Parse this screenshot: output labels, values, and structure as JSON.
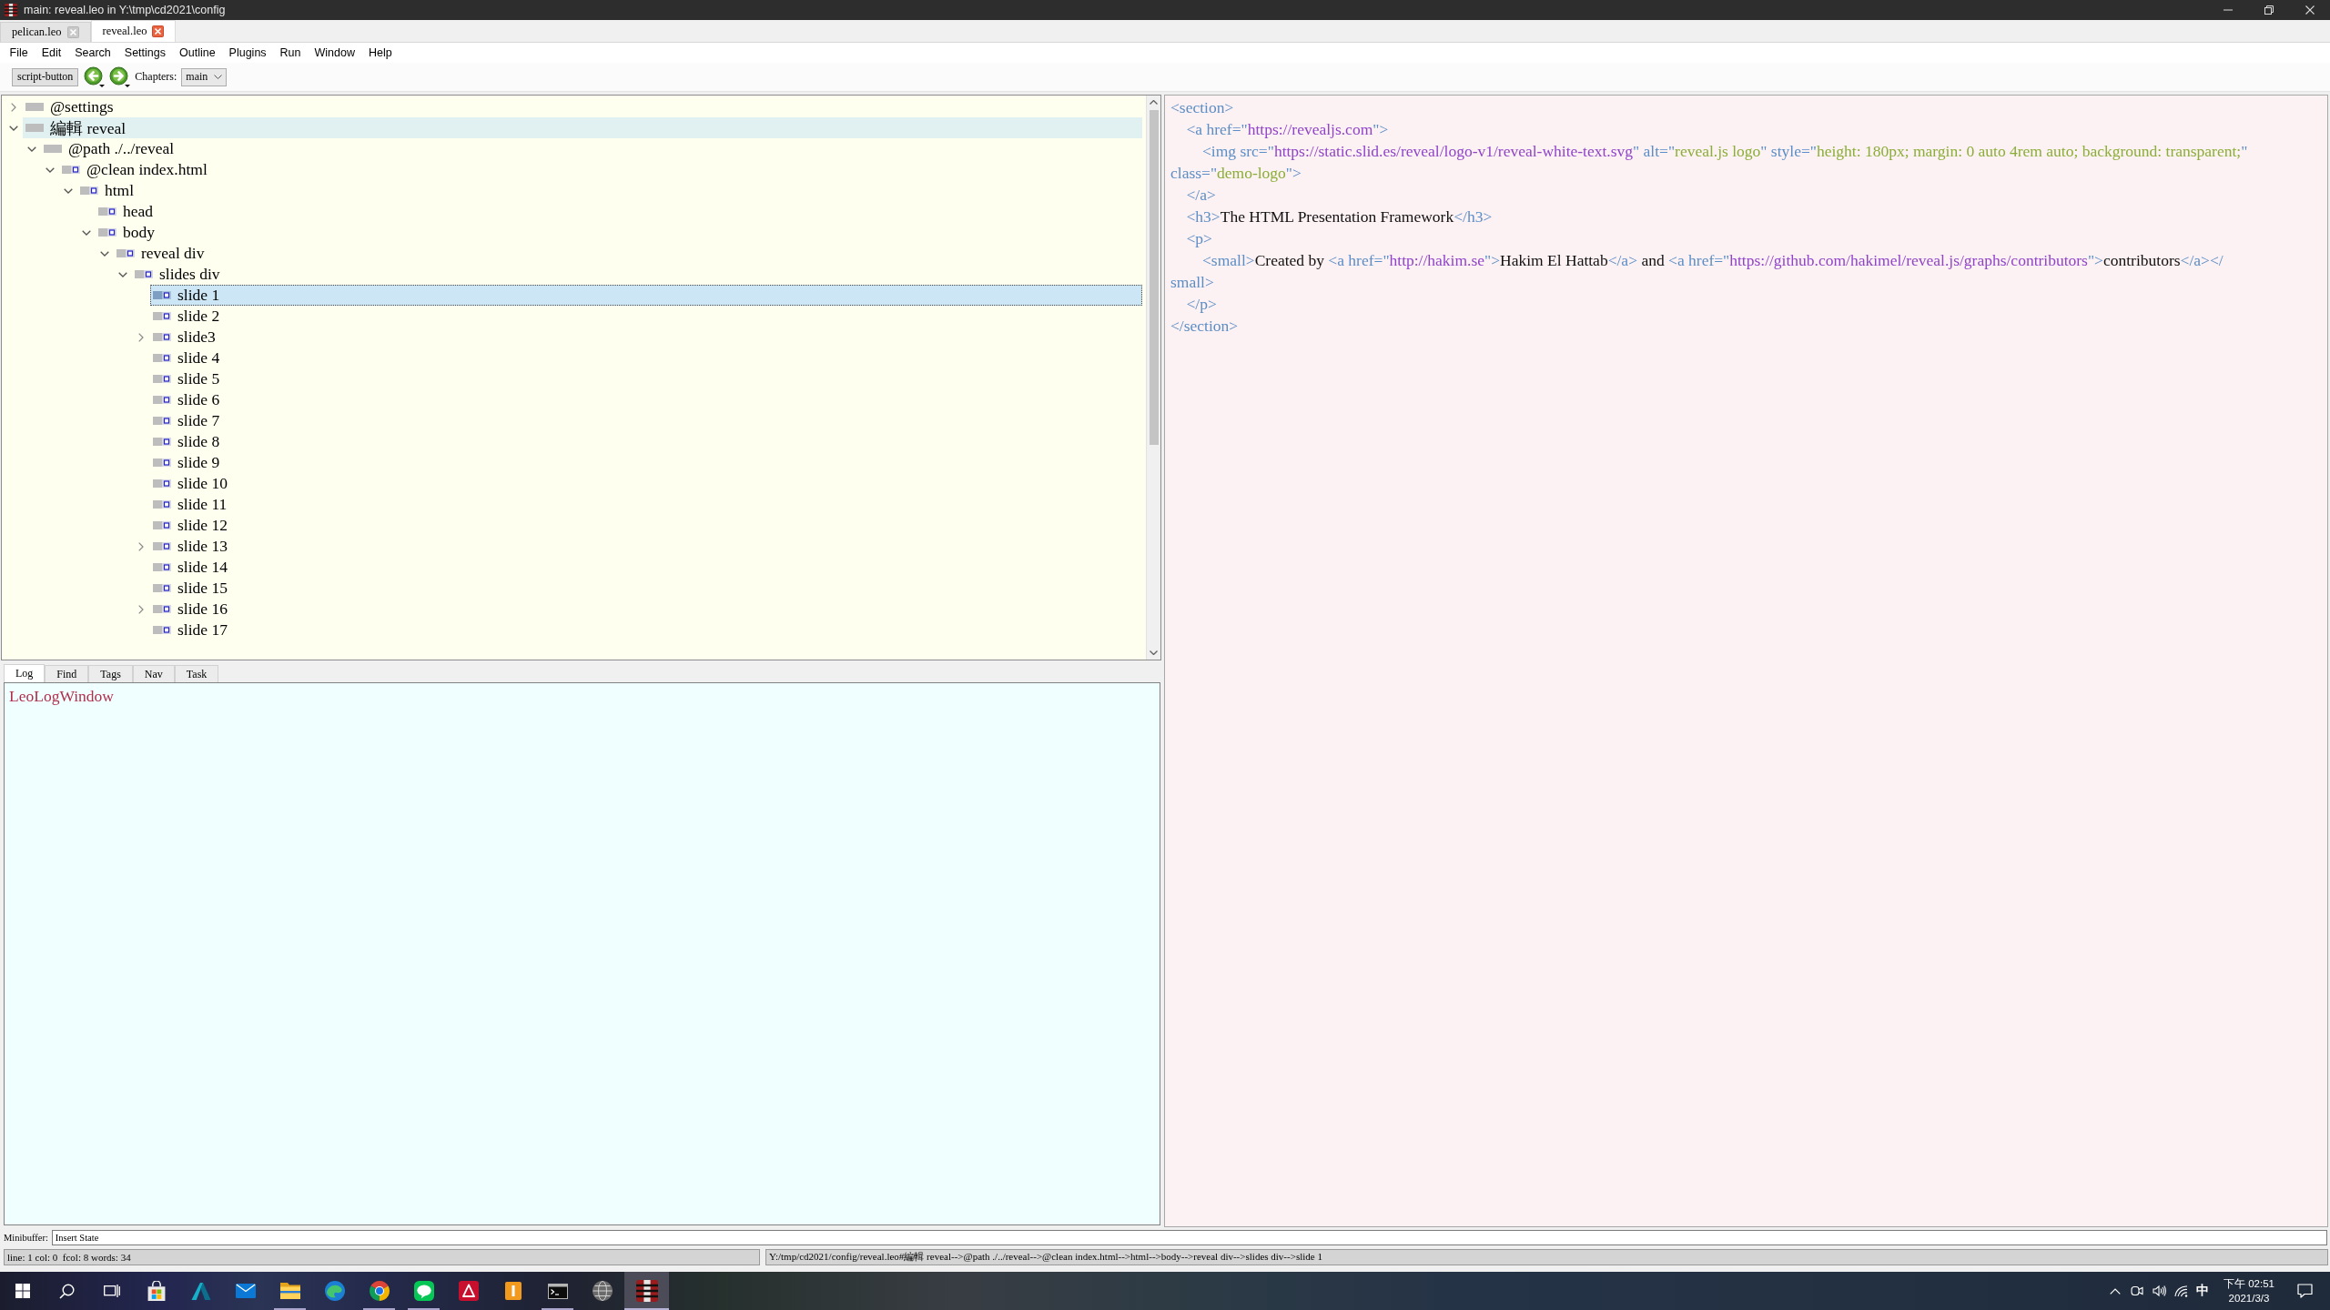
{
  "window": {
    "title": "main: reveal.leo in Y:\\tmp\\cd2021\\config"
  },
  "file_tabs": [
    {
      "label": "pelican.leo",
      "selected": false
    },
    {
      "label": "reveal.leo",
      "selected": true
    }
  ],
  "menu": [
    "File",
    "Edit",
    "Search",
    "Settings",
    "Outline",
    "Plugins",
    "Run",
    "Window",
    "Help"
  ],
  "toolbar": {
    "script_button": "script-button",
    "chapters_label": "Chapters:",
    "chapter": "main"
  },
  "outline": [
    {
      "label": "@settings",
      "kind": "branch",
      "expanded": false,
      "has_body": false,
      "selected": false,
      "hovered": false
    },
    {
      "label": "編輯 reveal",
      "kind": "branch",
      "expanded": true,
      "has_body": false,
      "selected": false,
      "hovered": true,
      "children": [
        {
          "label": "@path ./../reveal",
          "kind": "branch",
          "expanded": true,
          "has_body": false,
          "selected": false,
          "hovered": false,
          "children": [
            {
              "label": "@clean index.html",
              "kind": "branch",
              "expanded": true,
              "has_body": true,
              "selected": false,
              "hovered": false,
              "children": [
                {
                  "label": "html",
                  "kind": "branch",
                  "expanded": true,
                  "has_body": true,
                  "selected": false,
                  "hovered": false,
                  "children": [
                    {
                      "label": "head",
                      "kind": "leaf",
                      "has_body": true,
                      "selected": false,
                      "hovered": false
                    },
                    {
                      "label": "body",
                      "kind": "branch",
                      "expanded": true,
                      "has_body": true,
                      "selected": false,
                      "hovered": false,
                      "children": [
                        {
                          "label": "reveal div",
                          "kind": "branch",
                          "expanded": true,
                          "has_body": true,
                          "selected": false,
                          "hovered": false,
                          "children": [
                            {
                              "label": "slides div",
                              "kind": "branch",
                              "expanded": true,
                              "has_body": true,
                              "selected": false,
                              "hovered": false,
                              "children": [
                                {
                                  "label": "slide 1",
                                  "kind": "leaf",
                                  "has_body": true,
                                  "selected": true,
                                  "hovered": false
                                },
                                {
                                  "label": "slide 2",
                                  "kind": "leaf",
                                  "has_body": true,
                                  "selected": false,
                                  "hovered": false
                                },
                                {
                                  "label": "slide3",
                                  "kind": "branch",
                                  "expanded": false,
                                  "has_body": true,
                                  "selected": false,
                                  "hovered": false
                                },
                                {
                                  "label": "slide 4",
                                  "kind": "leaf",
                                  "has_body": true,
                                  "selected": false,
                                  "hovered": false
                                },
                                {
                                  "label": "slide 5",
                                  "kind": "leaf",
                                  "has_body": true,
                                  "selected": false,
                                  "hovered": false
                                },
                                {
                                  "label": "slide 6",
                                  "kind": "leaf",
                                  "has_body": true,
                                  "selected": false,
                                  "hovered": false
                                },
                                {
                                  "label": "slide 7",
                                  "kind": "leaf",
                                  "has_body": true,
                                  "selected": false,
                                  "hovered": false
                                },
                                {
                                  "label": "slide 8",
                                  "kind": "leaf",
                                  "has_body": true,
                                  "selected": false,
                                  "hovered": false
                                },
                                {
                                  "label": "slide 9",
                                  "kind": "leaf",
                                  "has_body": true,
                                  "selected": false,
                                  "hovered": false
                                },
                                {
                                  "label": "slide 10",
                                  "kind": "leaf",
                                  "has_body": true,
                                  "selected": false,
                                  "hovered": false
                                },
                                {
                                  "label": "slide 11",
                                  "kind": "leaf",
                                  "has_body": true,
                                  "selected": false,
                                  "hovered": false
                                },
                                {
                                  "label": "slide 12",
                                  "kind": "leaf",
                                  "has_body": true,
                                  "selected": false,
                                  "hovered": false
                                },
                                {
                                  "label": "slide 13",
                                  "kind": "branch",
                                  "expanded": false,
                                  "has_body": true,
                                  "selected": false,
                                  "hovered": false
                                },
                                {
                                  "label": "slide 14",
                                  "kind": "leaf",
                                  "has_body": true,
                                  "selected": false,
                                  "hovered": false
                                },
                                {
                                  "label": "slide 15",
                                  "kind": "leaf",
                                  "has_body": true,
                                  "selected": false,
                                  "hovered": false
                                },
                                {
                                  "label": "slide 16",
                                  "kind": "branch",
                                  "expanded": false,
                                  "has_body": true,
                                  "selected": false,
                                  "hovered": false
                                },
                                {
                                  "label": "slide 17",
                                  "kind": "leaf",
                                  "has_body": true,
                                  "selected": false,
                                  "hovered": false
                                }
                              ]
                            }
                          ]
                        }
                      ]
                    }
                  ]
                }
              ]
            }
          ]
        }
      ]
    }
  ],
  "log_tabs": [
    {
      "label": "Log",
      "selected": true
    },
    {
      "label": "Find",
      "selected": false
    },
    {
      "label": "Tags",
      "selected": false
    },
    {
      "label": "Nav",
      "selected": false
    },
    {
      "label": "Task",
      "selected": false
    }
  ],
  "log_lines": [
    "LeoLogWindow"
  ],
  "body_lines": [
    [
      {
        "kind": "tag",
        "text": "<section>"
      }
    ],
    [
      {
        "kind": "tag",
        "text": "    <a href=\""
      },
      {
        "kind": "url",
        "text": "https://revealjs.com"
      },
      {
        "kind": "tag",
        "text": "\">"
      }
    ],
    [
      {
        "kind": "tag",
        "text": "        <img src=\""
      },
      {
        "kind": "url",
        "text": "https://static.slid.es/reveal/logo-v1/reveal-white-text.svg"
      },
      {
        "kind": "tag",
        "text": "\" alt=\""
      },
      {
        "kind": "value",
        "text": "reveal.js logo"
      },
      {
        "kind": "tag",
        "text": "\" style=\""
      },
      {
        "kind": "value",
        "text": "height: 180px; margin: 0 auto 4rem auto; background: transparent;"
      },
      {
        "kind": "tag",
        "text": "\""
      }
    ],
    [
      {
        "kind": "tag",
        "text": "class=\""
      },
      {
        "kind": "value",
        "text": "demo-logo"
      },
      {
        "kind": "tag",
        "text": "\">"
      }
    ],
    [
      {
        "kind": "tag",
        "text": "    </a>"
      }
    ],
    [
      {
        "kind": "tag",
        "text": "    <h3>"
      },
      {
        "kind": "text",
        "text": "The HTML Presentation Framework"
      },
      {
        "kind": "tag",
        "text": "</h3>"
      }
    ],
    [
      {
        "kind": "tag",
        "text": "    <p>"
      }
    ],
    [
      {
        "kind": "tag",
        "text": "        <small>"
      },
      {
        "kind": "text",
        "text": "Created by "
      },
      {
        "kind": "tag",
        "text": "<a href=\""
      },
      {
        "kind": "url",
        "text": "http://hakim.se"
      },
      {
        "kind": "tag",
        "text": "\">"
      },
      {
        "kind": "text",
        "text": "Hakim El Hattab"
      },
      {
        "kind": "tag",
        "text": "</a>"
      },
      {
        "kind": "text",
        "text": " and "
      },
      {
        "kind": "tag",
        "text": "<a href=\""
      },
      {
        "kind": "url",
        "text": "https://github.com/hakimel/reveal.js/graphs/contributors"
      },
      {
        "kind": "tag",
        "text": "\">"
      },
      {
        "kind": "text",
        "text": "contributors"
      },
      {
        "kind": "tag",
        "text": "</a></"
      }
    ],
    [
      {
        "kind": "tag",
        "text": "small>"
      }
    ],
    [
      {
        "kind": "tag",
        "text": "    </p>"
      }
    ],
    [
      {
        "kind": "tag",
        "text": "</section>"
      }
    ]
  ],
  "minibuffer": {
    "label": "Minibuffer:",
    "value": "Insert State"
  },
  "status_bar": {
    "position": "line: 1 col: 0  fcol: 8 words: 34",
    "path": "Y:/tmp/cd2021/config/reveal.leo#編輯 reveal-->@path ./../reveal-->@clean index.html-->html-->body-->reveal div-->slides div-->slide 1"
  },
  "taskbar": {
    "apps": [
      {
        "kind": "start",
        "running": false,
        "active": false
      },
      {
        "kind": "search",
        "running": false,
        "active": false
      },
      {
        "kind": "taskview",
        "running": false,
        "active": false
      },
      {
        "kind": "store",
        "running": false,
        "active": false
      },
      {
        "kind": "triangle",
        "running": false,
        "active": false
      },
      {
        "kind": "mail",
        "running": false,
        "active": false
      },
      {
        "kind": "folder",
        "running": true,
        "active": false
      },
      {
        "kind": "swirl",
        "running": false,
        "active": false
      },
      {
        "kind": "segmented",
        "running": true,
        "active": false
      },
      {
        "kind": "chat",
        "running": true,
        "active": false
      },
      {
        "kind": "swoosh",
        "running": false,
        "active": false
      },
      {
        "kind": "bartile",
        "running": false,
        "active": false
      },
      {
        "kind": "terminal",
        "running": true,
        "active": false
      },
      {
        "kind": "sphere",
        "running": false,
        "active": false
      },
      {
        "kind": "logo",
        "running": true,
        "active": true
      }
    ],
    "tray": {
      "ime": "中",
      "time": "下午 02:51",
      "date": "2021/3/3"
    }
  }
}
